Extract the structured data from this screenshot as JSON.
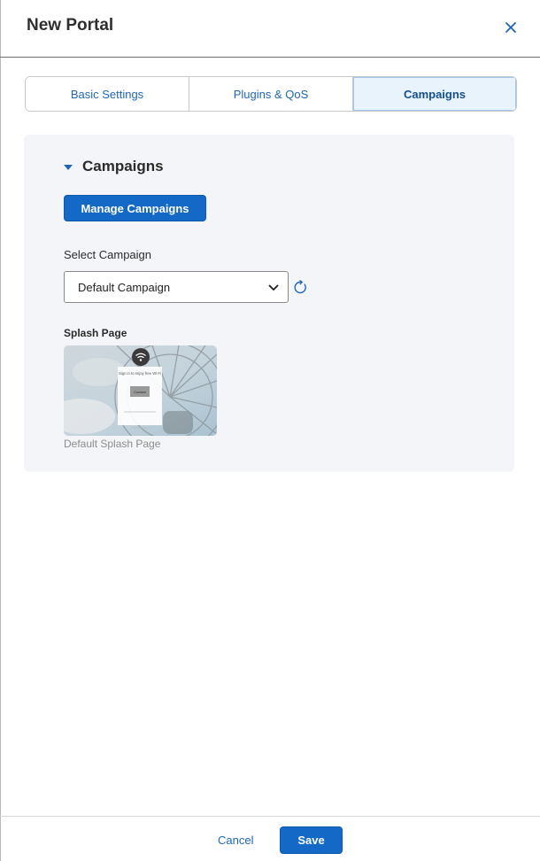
{
  "header": {
    "title": "New Portal",
    "close_icon": "close-icon"
  },
  "tabs": [
    {
      "label": "Basic Settings",
      "active": false
    },
    {
      "label": "Plugins & QoS",
      "active": false
    },
    {
      "label": "Campaigns",
      "active": true
    }
  ],
  "campaigns": {
    "section_title": "Campaigns",
    "manage_label": "Manage Campaigns",
    "select_label": "Select Campaign",
    "selected_campaign": "Default Campaign",
    "splash_label": "Splash Page",
    "splash_caption": "Default Splash Page",
    "preview": {
      "heading": "Sign in to enjoy free Wi-Fi",
      "button": "Connect"
    }
  },
  "footer": {
    "cancel_label": "Cancel",
    "save_label": "Save"
  },
  "colors": {
    "accent": "#1468c6",
    "link": "#1e66b4",
    "active_tab_bg": "#e8f3fc",
    "panel_bg": "#f4f5f8"
  }
}
